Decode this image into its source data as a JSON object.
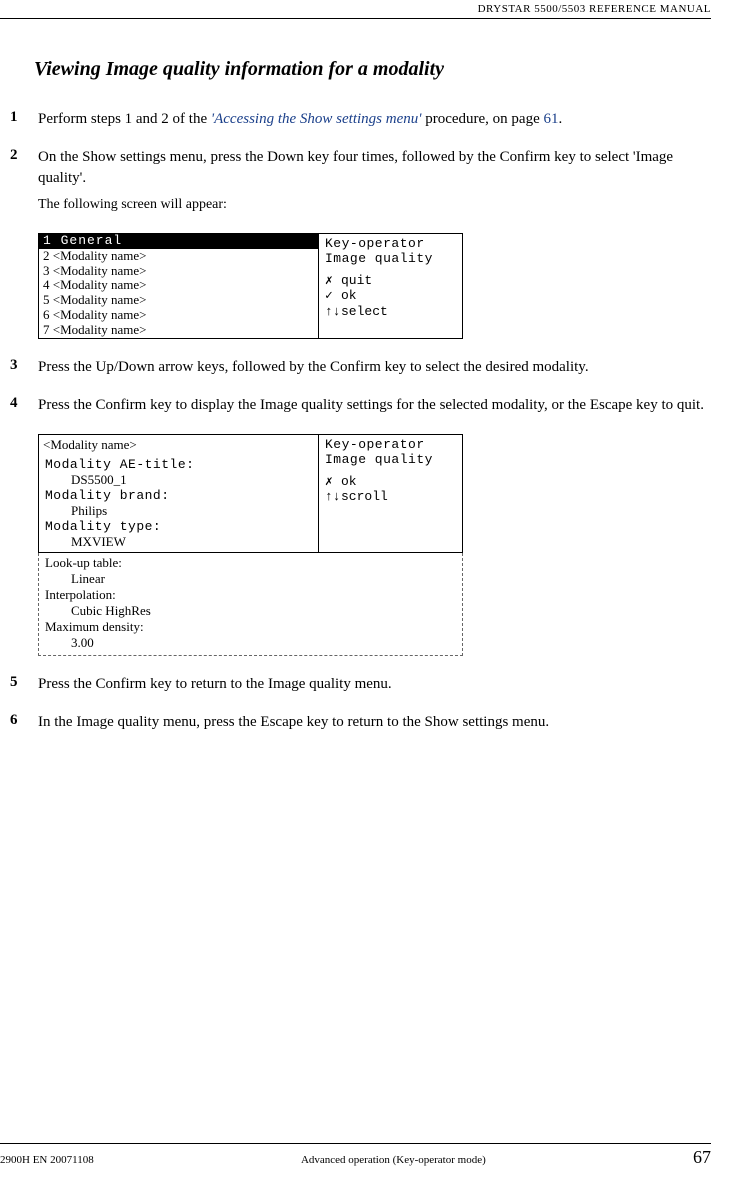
{
  "header": {
    "manual_title": "DRYSTAR 5500/5503 REFERENCE MANUAL"
  },
  "section_title": "Viewing Image quality information for a modality",
  "steps": [
    {
      "num": "1",
      "text_pre": "Perform steps 1 and 2 of the ",
      "link": "'Accessing the Show settings menu'",
      "text_mid": " procedure, on page ",
      "page_ref": "61",
      "text_post": "."
    },
    {
      "num": "2",
      "text": "On the Show settings menu, press the Down key four times, followed by the Confirm key to select 'Image quality'.",
      "sub": "The following screen will appear:"
    },
    {
      "num": "3",
      "text": "Press the Up/Down arrow keys, followed by the Confirm key to select the desired modality."
    },
    {
      "num": "4",
      "text": "Press the Confirm key to display the Image quality settings for the selected modality, or the Escape key to quit."
    },
    {
      "num": "5",
      "text": "Press the Confirm key to return to the Image quality menu."
    },
    {
      "num": "6",
      "text": "In the Image quality menu, press the Escape key to return to the Show settings menu."
    }
  ],
  "screen1": {
    "left_rows": [
      {
        "text": "1 General",
        "selected": true
      },
      {
        "text": "2 <Modality name>",
        "selected": false
      },
      {
        "text": "3 <Modality name>",
        "selected": false
      },
      {
        "text": "4 <Modality name>",
        "selected": false
      },
      {
        "text": "5 <Modality name>",
        "selected": false
      },
      {
        "text": "6 <Modality name>",
        "selected": false
      },
      {
        "text": "7 <Modality name>",
        "selected": false
      }
    ],
    "right_header_1": "Key-operator",
    "right_header_2": "Image quality",
    "actions": [
      {
        "icon": "✗",
        "label": "quit"
      },
      {
        "icon": "✓",
        "label": "ok"
      },
      {
        "icon": "↑↓",
        "label": "select"
      }
    ]
  },
  "screen2": {
    "title": "<Modality name>",
    "fields_top": [
      {
        "label": "Modality AE-title:",
        "value": "DS5500_1"
      },
      {
        "label": "Modality brand:",
        "value": "Philips"
      },
      {
        "label": "Modality type:",
        "value": "MXVIEW"
      }
    ],
    "fields_scroll": [
      {
        "label": "Look-up table:",
        "value": "Linear"
      },
      {
        "label": "Interpolation:",
        "value": "Cubic HighRes"
      },
      {
        "label": "Maximum density:",
        "value": "3.00"
      }
    ],
    "right_header_1": "Key-operator",
    "right_header_2": "Image quality",
    "actions": [
      {
        "icon": "✗",
        "label": "ok"
      },
      {
        "icon": "↑↓",
        "label": "scroll"
      }
    ]
  },
  "footer": {
    "doc_id": "2900H EN 20071108",
    "section_name": "Advanced operation (Key-operator mode)",
    "page": "67"
  }
}
